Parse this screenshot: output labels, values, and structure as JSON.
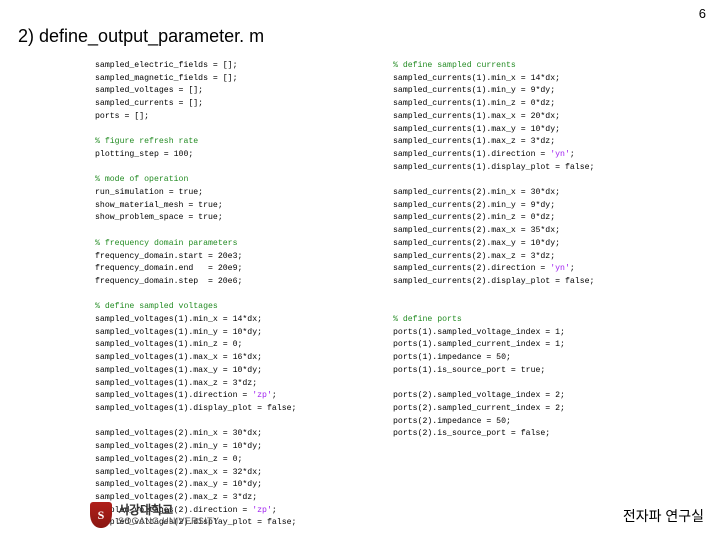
{
  "page_number": "6",
  "title": "2) define_output_parameter. m",
  "code": {
    "col1": [
      {
        "t": "sampled_electric_fields = [];"
      },
      {
        "t": "sampled_magnetic_fields = [];"
      },
      {
        "t": "sampled_voltages = [];"
      },
      {
        "t": "sampled_currents = [];"
      },
      {
        "t": "ports = [];"
      },
      {
        "t": ""
      },
      {
        "t": "% figure refresh rate",
        "c": "comment"
      },
      {
        "t": "plotting_step = 100;"
      },
      {
        "t": ""
      },
      {
        "t": "% mode of operation",
        "c": "comment"
      },
      {
        "t": "run_simulation = true;"
      },
      {
        "t": "show_material_mesh = true;"
      },
      {
        "t": "show_problem_space = true;"
      },
      {
        "t": ""
      },
      {
        "t": "% frequency domain parameters",
        "c": "comment"
      },
      {
        "t": "frequency_domain.start = 20e3;"
      },
      {
        "t": "frequency_domain.end   = 20e9;"
      },
      {
        "t": "frequency_domain.step  = 20e6;"
      },
      {
        "t": ""
      },
      {
        "t": "% define sampled voltages",
        "c": "comment"
      },
      {
        "t": "sampled_voltages(1).min_x = 14*dx;"
      },
      {
        "t": "sampled_voltages(1).min_y = 10*dy;"
      },
      {
        "t": "sampled_voltages(1).min_z = 0;"
      },
      {
        "t": "sampled_voltages(1).max_x = 16*dx;"
      },
      {
        "t": "sampled_voltages(1).max_y = 10*dy;"
      },
      {
        "t": "sampled_voltages(1).max_z = 3*dz;"
      },
      {
        "t": "sampled_voltages(1).direction = 'zp';"
      },
      {
        "t": "sampled_voltages(1).display_plot = false;"
      },
      {
        "t": ""
      },
      {
        "t": "sampled_voltages(2).min_x = 30*dx;"
      },
      {
        "t": "sampled_voltages(2).min_y = 10*dy;"
      },
      {
        "t": "sampled_voltages(2).min_z = 0;"
      },
      {
        "t": "sampled_voltages(2).max_x = 32*dx;"
      },
      {
        "t": "sampled_voltages(2).max_y = 10*dy;"
      },
      {
        "t": "sampled_voltages(2).max_z = 3*dz;"
      },
      {
        "t": "sampled_voltages(2).direction = 'zp';"
      },
      {
        "t": "sampled_voltages(2).display_plot = false;"
      }
    ],
    "col2": [
      {
        "t": "% define sampled currents",
        "c": "comment"
      },
      {
        "t": "sampled_currents(1).min_x = 14*dx;"
      },
      {
        "t": "sampled_currents(1).min_y = 9*dy;"
      },
      {
        "t": "sampled_currents(1).min_z = 0*dz;"
      },
      {
        "t": "sampled_currents(1).max_x = 20*dx;"
      },
      {
        "t": "sampled_currents(1).max_y = 10*dy;"
      },
      {
        "t": "sampled_currents(1).max_z = 3*dz;"
      },
      {
        "t": "sampled_currents(1).direction = 'yn';"
      },
      {
        "t": "sampled_currents(1).display_plot = false;"
      },
      {
        "t": ""
      },
      {
        "t": "sampled_currents(2).min_x = 30*dx;"
      },
      {
        "t": "sampled_currents(2).min_y = 9*dy;"
      },
      {
        "t": "sampled_currents(2).min_z = 0*dz;"
      },
      {
        "t": "sampled_currents(2).max_x = 35*dx;"
      },
      {
        "t": "sampled_currents(2).max_y = 10*dy;"
      },
      {
        "t": "sampled_currents(2).max_z = 3*dz;"
      },
      {
        "t": "sampled_currents(2).direction = 'yn';"
      },
      {
        "t": "sampled_currents(2).display_plot = false;"
      },
      {
        "t": ""
      },
      {
        "t": ""
      },
      {
        "t": "% define ports",
        "c": "comment"
      },
      {
        "t": "ports(1).sampled_voltage_index = 1;"
      },
      {
        "t": "ports(1).sampled_current_index = 1;"
      },
      {
        "t": "ports(1).impedance = 50;"
      },
      {
        "t": "ports(1).is_source_port = true;"
      },
      {
        "t": ""
      },
      {
        "t": "ports(2).sampled_voltage_index = 2;"
      },
      {
        "t": "ports(2).sampled_current_index = 2;"
      },
      {
        "t": "ports(2).impedance = 50;"
      },
      {
        "t": "ports(2).is_source_port = false;"
      }
    ]
  },
  "logo": {
    "kr": "서강대학교",
    "en": "SOGANG UNIVERSITY"
  },
  "lab": "전자파 연구실"
}
